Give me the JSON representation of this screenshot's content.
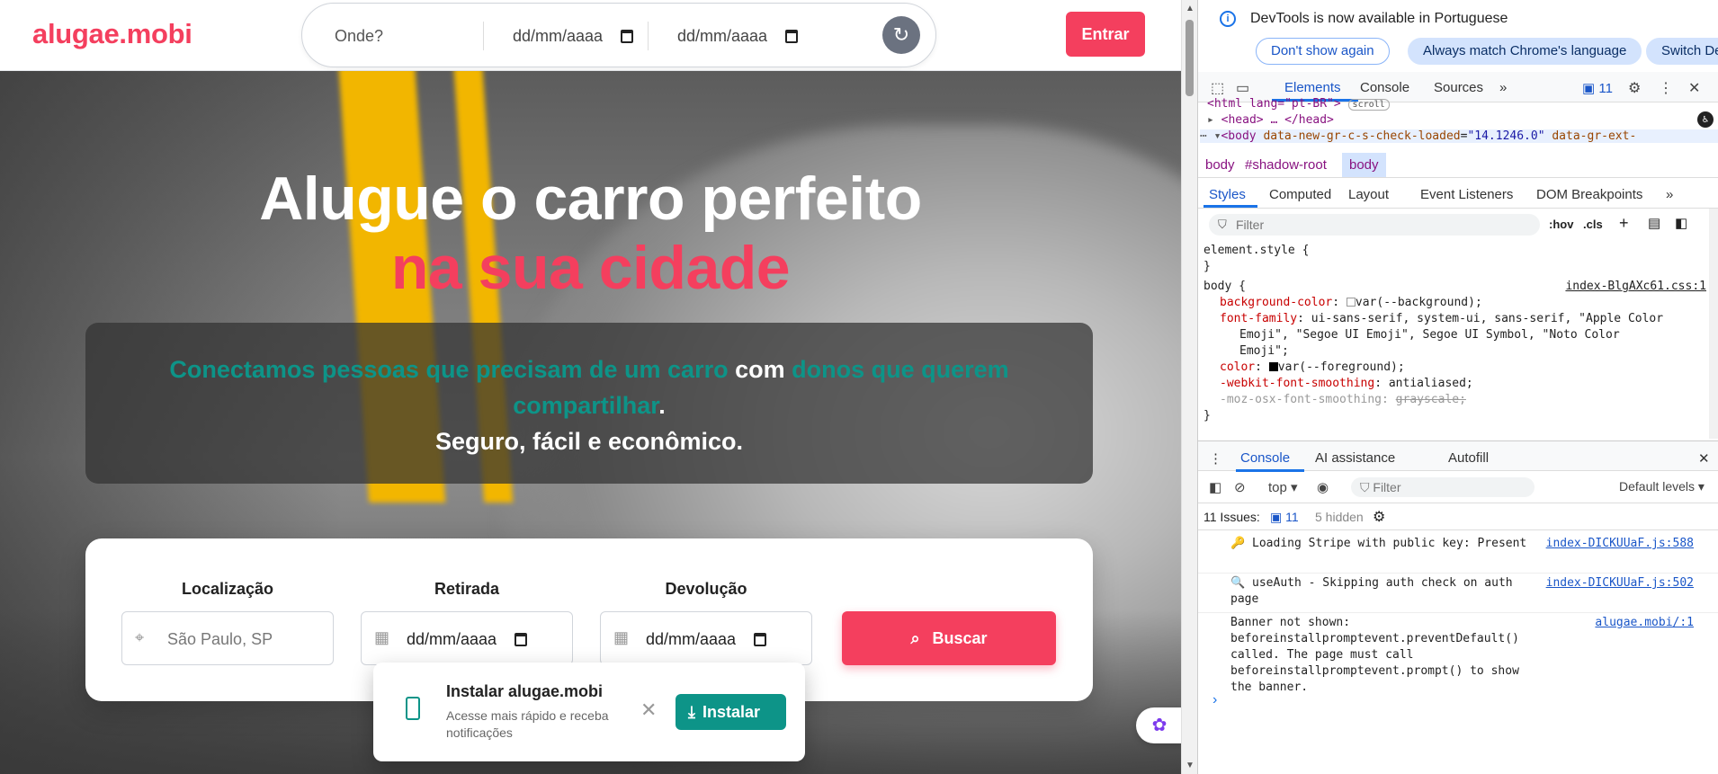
{
  "site": {
    "logo": "alugae.mobi",
    "nav_search": {
      "where_placeholder": "Onde?",
      "date1": "dd/mm/aaaa",
      "date2": "dd/mm/aaaa",
      "reset_icon": "refresh-icon"
    },
    "login_label": "Entrar"
  },
  "hero": {
    "title_line1": "Alugue o carro perfeito",
    "title_line2": "na sua cidade",
    "tagline": {
      "part1": "Conectamos pessoas que precisam de um carro",
      "part2": " com ",
      "part3": "donos que querem compartilhar",
      "part4": ".",
      "line2": "Seguro, fácil e econômico."
    }
  },
  "search_card": {
    "location_label": "Localização",
    "location_placeholder": "São Paulo, SP",
    "pickup_label": "Retirada",
    "pickup_value": "dd/mm/aaaa",
    "return_label": "Devolução",
    "return_value": "dd/mm/aaaa",
    "search_button": "Buscar"
  },
  "install_prompt": {
    "title": "Instalar alugae.mobi",
    "description": "Acesse mais rápido e receba notificações",
    "button": "Instalar"
  },
  "devtools": {
    "banner": {
      "text": "DevTools is now available in Portuguese",
      "btn_dismiss": "Don't show again",
      "btn_match": "Always match Chrome's language",
      "btn_switch": "Switch Dev"
    },
    "tabs": [
      "Elements",
      "Console",
      "Sources"
    ],
    "issues_count": "11",
    "dom": {
      "html_line": "<html lang=\"pt-BR\">",
      "scroll_badge": "scroll",
      "head_line": "<head> … </head>",
      "body_tag": "<body",
      "body_attr": "data-new-gr-c-s-check-loaded",
      "body_val": "\"14.1246.0\"",
      "body_attr2": "data-gr-ext-"
    },
    "breadcrumbs": [
      "body",
      "#shadow-root",
      "body"
    ],
    "subtabs": [
      "Styles",
      "Computed",
      "Layout",
      "Event Listeners",
      "DOM Breakpoints"
    ],
    "filter_placeholder": "Filter",
    "filter_hov": ":hov",
    "filter_cls": ".cls",
    "styles": {
      "element_style": "element.style {",
      "close": "}",
      "body_rule": "body {",
      "source": "index-BlgAXc61.css:1",
      "props": [
        {
          "name": "background-color",
          "value": "var(--background);"
        },
        {
          "name": "font-family",
          "value": "ui-sans-serif, system-ui, sans-serif, \"Apple Color"
        },
        {
          "name": "",
          "value": "Emoji\", \"Segoe UI Emoji\", Segoe UI Symbol, \"Noto Color"
        },
        {
          "name": "",
          "value": "Emoji\";"
        },
        {
          "name": "color",
          "value": "var(--foreground);"
        },
        {
          "name": "-webkit-font-smoothing",
          "value": "antialiased;"
        },
        {
          "name": "-moz-osx-font-smoothing",
          "value": "grayscale;"
        }
      ]
    },
    "console_tabs": [
      "Console",
      "AI assistance",
      "Autofill"
    ],
    "console_tools": {
      "context": "top",
      "filter": "Filter",
      "levels": "Default levels"
    },
    "issues_bar": {
      "label": "11 Issues:",
      "count": "11",
      "hidden": "5 hidden"
    },
    "messages": [
      {
        "icon": "🔑",
        "text": "Loading Stripe with public key: Present",
        "source": "index-DICKUUaF.js:588"
      },
      {
        "icon": "🔍",
        "text": "useAuth - Skipping auth check on auth page",
        "source": "index-DICKUUaF.js:502"
      },
      {
        "icon": "",
        "text": "Banner not shown: beforeinstallpromptevent.preventDefault() called. The page must call beforeinstallpromptevent.prompt() to show the banner.",
        "source": "alugae.mobi/:1"
      }
    ]
  }
}
